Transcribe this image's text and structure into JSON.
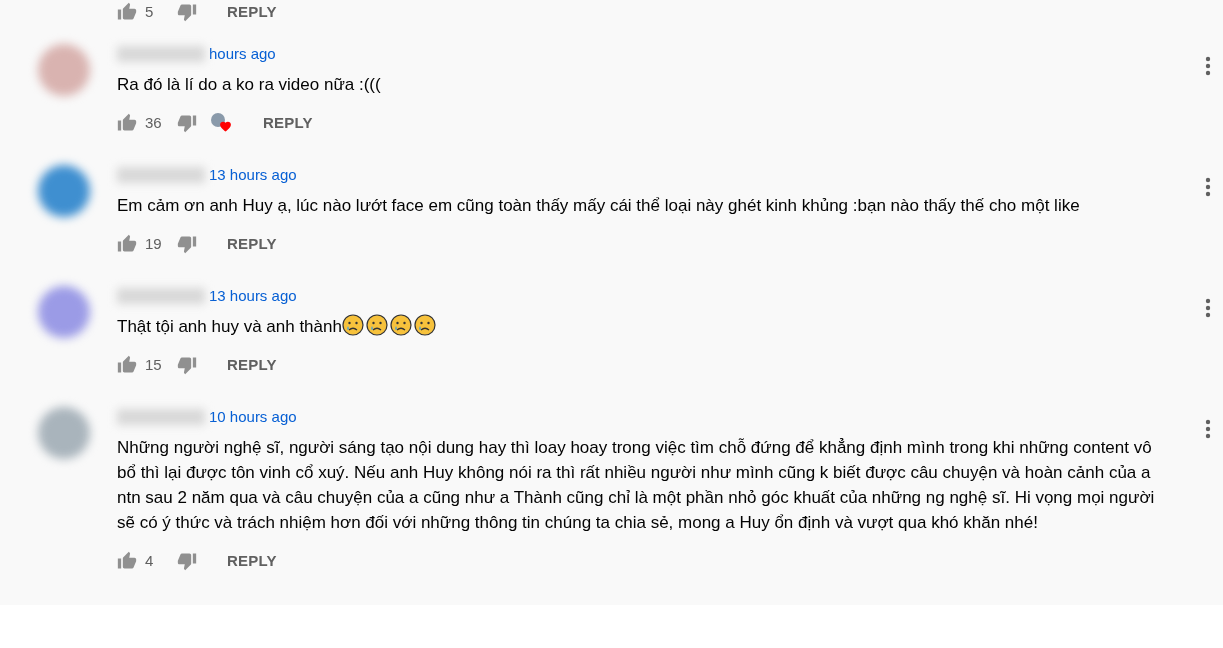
{
  "previous_actions": {
    "likes": "5",
    "reply": "REPLY"
  },
  "comments": [
    {
      "time": "hours ago",
      "text": "Ra đó là lí do a ko ra video nữa :(((",
      "likes": "36",
      "creator_hearted": true,
      "reply": "REPLY"
    },
    {
      "time": "13 hours ago",
      "text": "Em cảm ơn anh Huy ạ, lúc nào lướt face em cũng toàn thấy mấy cái thể loại này ghét kinh khủng :bạn nào thấy thế cho một like",
      "likes": "19",
      "creator_hearted": false,
      "reply": "REPLY"
    },
    {
      "time": "13 hours ago",
      "text": "Thật tội anh huy và anh thành",
      "emojis": [
        {
          "kind": "crying"
        },
        {
          "kind": "crying"
        },
        {
          "kind": "crying"
        },
        {
          "kind": "crying"
        }
      ],
      "likes": "15",
      "creator_hearted": false,
      "reply": "REPLY"
    },
    {
      "time": "10 hours ago",
      "text": "Những người nghệ sĩ, người sáng tạo nội dung hay thì loay hoay trong việc tìm chỗ đứng để khẳng định mình trong khi những content vô bổ thì lại được tôn vinh cổ xuý. Nếu anh Huy không nói ra thì rất nhiều người như mình cũng k biết được câu chuyện và hoàn cảnh của a ntn sau 2 năm qua và câu chuyện của a cũng như a Thành cũng chỉ là một phần nhỏ góc khuất của những ng nghệ sĩ. Hi vọng mọi người sẽ có ý thức và trách nhiệm hơn đối với những thông tin chúng ta chia sẻ, mong a Huy ổn định và vượt qua khó khăn nhé!",
      "likes": "4",
      "creator_hearted": false,
      "reply": "REPLY"
    }
  ]
}
